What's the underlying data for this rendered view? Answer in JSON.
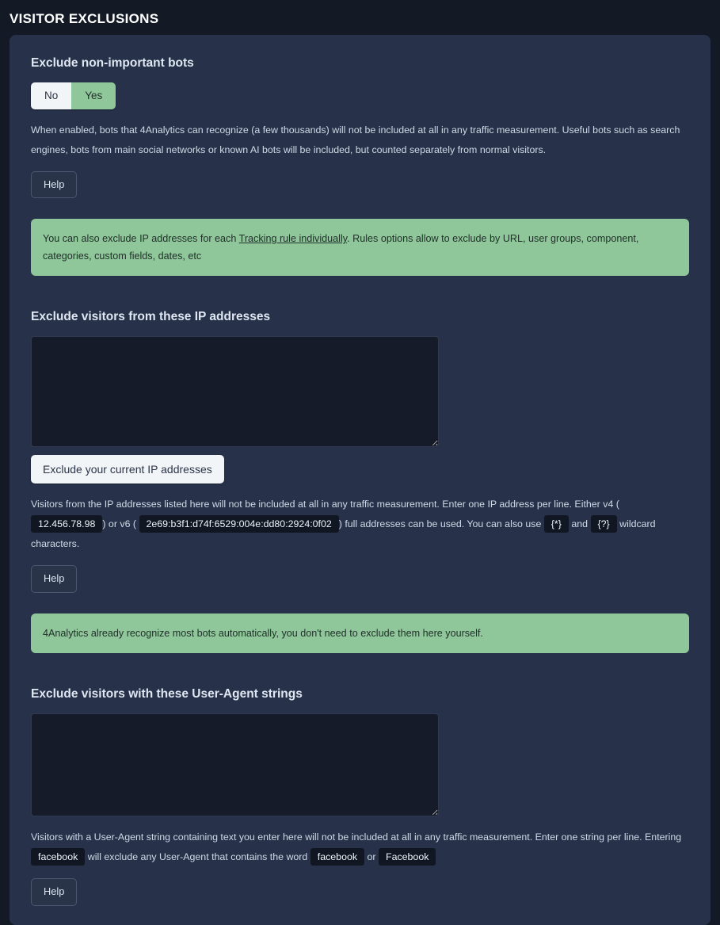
{
  "page": {
    "title": "VISITOR EXCLUSIONS"
  },
  "colors": {
    "page_background": "#131a26",
    "card_background": "#27324a",
    "notice_green": "#90c79a",
    "toggle_on_green": "#90c79a",
    "toggle_off_light": "#f2f5f8",
    "code_badge_background": "#111722",
    "textarea_background": "#151b28"
  },
  "sections": {
    "bots": {
      "title": "Exclude non-important bots",
      "toggle": {
        "off_label": "No",
        "on_label": "Yes",
        "selected": "Yes"
      },
      "description": "When enabled, bots that 4Analytics can recognize (a few thousands) will not be included at all in any traffic measurement. Useful bots such as search engines, bots from main social networks or known AI bots will be included, but counted separately from normal visitors.",
      "help_label": "Help"
    },
    "notice_tracking_rules": {
      "text_before_link": "You can also exclude IP addresses for each ",
      "link_label": "Tracking rule individually",
      "text_after_link": ". Rules options allow to exclude by URL, user groups, component, categories, custom fields, dates, etc"
    },
    "ip": {
      "title": "Exclude visitors from these IP addresses",
      "textarea_value": "",
      "textarea_placeholder": "",
      "exclude_current_ip_label": "Exclude your current IP addresses",
      "description_part_1": "Visitors from the IP addresses listed here will not be included at all in any traffic measurement. Enter one IP address per line. Either v4 (",
      "code_v4": "12.456.78.98",
      "description_part_2": ") or v6 (",
      "code_v6": "2e69:b3f1:d74f:6529:004e:dd80:2924:0f02",
      "description_part_3": ") full addresses can be used. You can also use",
      "code_wildcard_star": "{*}",
      "description_part_4": "and",
      "code_wildcard_question": "{?}",
      "description_part_5": "wildcard characters.",
      "help_label": "Help"
    },
    "notice_bots_recognized": {
      "text": "4Analytics already recognize most bots automatically, you don't need to exclude them here yourself."
    },
    "user_agent": {
      "title": "Exclude visitors with these User-Agent strings",
      "textarea_value": "",
      "textarea_placeholder": "",
      "description_part_1": "Visitors with a User-Agent string containing text you enter here will not be included at all in any traffic measurement. Enter one string per line. Entering",
      "code_facebook_lower_a": "facebook",
      "description_part_2": "will exclude any User-Agent that contains the word",
      "code_facebook_lower_b": "facebook",
      "description_part_3": "or",
      "code_facebook_upper": "Facebook",
      "help_label": "Help"
    }
  }
}
